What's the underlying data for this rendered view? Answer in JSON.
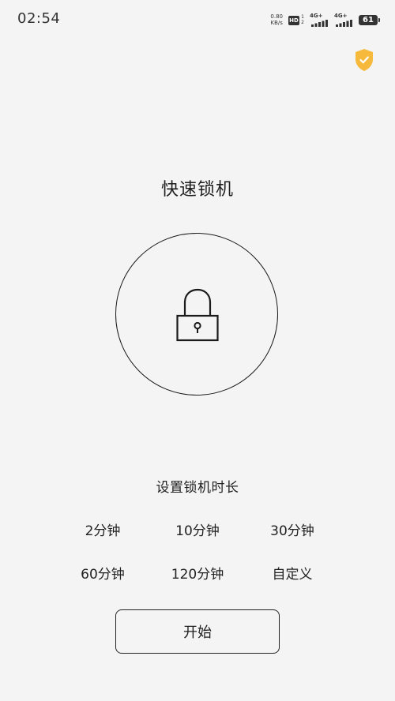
{
  "status_bar": {
    "time": "02:54",
    "net_speed_value": "0.80",
    "net_speed_unit": "KB/s",
    "hd_label": "HD",
    "hd_sub_top": "1",
    "hd_sub_bottom": "2",
    "signal_1_label": "4G+",
    "signal_2_label": "4G+",
    "battery_level": "61"
  },
  "header": {
    "shield_icon_color": "#f6b93b"
  },
  "main": {
    "title": "快速锁机",
    "duration_section_label": "设置锁机时长",
    "duration_options": [
      {
        "label": "2分钟"
      },
      {
        "label": "10分钟"
      },
      {
        "label": "30分钟"
      },
      {
        "label": "60分钟"
      },
      {
        "label": "120分钟"
      },
      {
        "label": "自定义"
      }
    ],
    "start_button_label": "开始"
  },
  "icons": {
    "shield": "shield-check-icon",
    "lock": "padlock-icon"
  }
}
